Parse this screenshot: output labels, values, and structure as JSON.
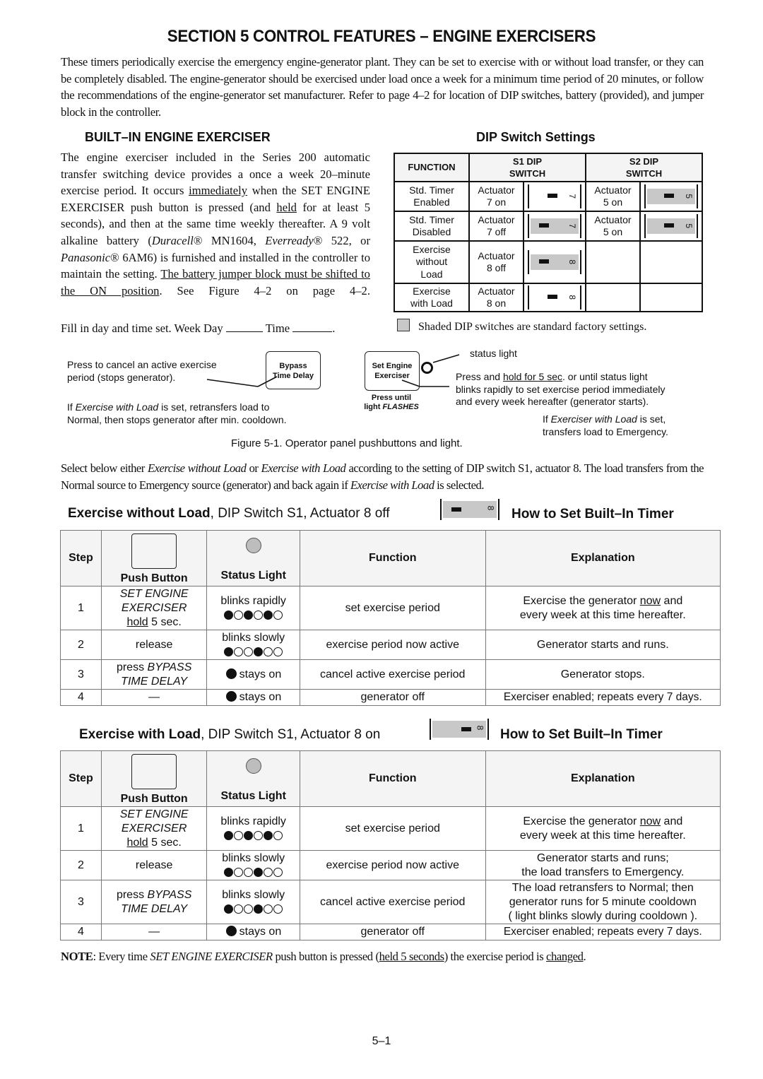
{
  "title": "SECTION 5  CONTROL FEATURES – ENGINE EXERCISERS",
  "intro": "These timers periodically exercise the emergency engine-generator plant.  They can be set to exercise with or without load transfer, or they can be completely disabled.  The engine-generator should be exercised under load once a week for a minimum time period of 20 minutes, or follow the recommendations of the engine-generator set manufacturer.  Refer to page 4–2 for location of DIP switches, battery (provided), and jumper block in the controller.",
  "builtin": {
    "heading": "BUILT–IN ENGINE EXERCISER",
    "p1": "The engine exerciser included in the Series 200 automatic transfer switching device provides a once a week 20–minute exercise period.  It occurs ",
    "u_immediately": "immediately",
    "p2": " when the SET ENGINE EXERCISER push button is pressed (and ",
    "u_held": "held",
    "p3": " for at least 5 seconds), and then at the same time weekly thereafter.  A 9 volt alkaline battery (",
    "duracell": "Duracell",
    "reg": "®",
    "p4": " MN1604, ",
    "everready": "Everready",
    "p5": " 522, or ",
    "panasonic": "Panasonic",
    "p6": " 6AM6) is furnished and installed in the controller to maintain the setting.  ",
    "u_jumper": "The battery jumper block must be shifted to the ON position",
    "p7": ".  See Figure 4–2 on page 4–2.",
    "fillin_prefix": "Fill in day and time set.  Week Day ",
    "fillin_time": " Time ",
    "fillin_end": "."
  },
  "dip": {
    "heading": "DIP Switch Settings",
    "col_function": "FUNCTION",
    "col_s1": [
      "S1 DIP",
      "SWITCH"
    ],
    "col_s2": [
      "S2 DIP",
      "SWITCH"
    ],
    "rows": [
      {
        "function": [
          "Std. Timer",
          "Enabled"
        ],
        "s1_label": [
          "Actuator",
          "7 on"
        ],
        "s1_num": "7",
        "s1_state": "on",
        "s1_shaded": false,
        "s2_label": [
          "Actuator",
          "5 on"
        ],
        "s2_num": "5",
        "s2_state": "on",
        "s2_shaded": true
      },
      {
        "function": [
          "Std. Timer",
          "Disabled"
        ],
        "s1_label": [
          "Actuator",
          "7 off"
        ],
        "s1_num": "7",
        "s1_state": "off",
        "s1_shaded": true,
        "s2_label": [
          "Actuator",
          "5 on"
        ],
        "s2_num": "5",
        "s2_state": "on",
        "s2_shaded": true
      },
      {
        "function": [
          "Exercise",
          "without",
          "Load"
        ],
        "s1_label": [
          "Actuator",
          "8 off"
        ],
        "s1_num": "8",
        "s1_state": "off",
        "s1_shaded": true
      },
      {
        "function": [
          "Exercise",
          "with Load"
        ],
        "s1_label": [
          "Actuator",
          "8 on"
        ],
        "s1_num": "8",
        "s1_state": "on",
        "s1_shaded": false
      }
    ],
    "legend": "Shaded DIP switches are standard factory settings.",
    "shade_color": "#c8c8c8"
  },
  "figure": {
    "bypass_callout": [
      "Press to cancel an active exercise",
      "period (stops generator)."
    ],
    "bypass_button": [
      "Bypass",
      "Time Delay"
    ],
    "bypass_note_pre": "If ",
    "bypass_note_it": "Exercise with Load",
    "bypass_note_post": " is set, retransfers load to",
    "bypass_note_2": "Normal, then stops generator after min. cooldown.",
    "set_button": [
      "Set Engine",
      "Exerciser"
    ],
    "press_until": "Press until",
    "light_flashes_pre": "light ",
    "light_flashes_it": "FLASHES",
    "status_light": "status light",
    "press_hold_pre": "Press and ",
    "press_hold_u": "hold for 5 sec",
    "press_hold_post": ". or until status light",
    "press_hold_2": "blinks rapidly to set exercise period immediately",
    "press_hold_3": "and every week hereafter (generator starts).",
    "ex_load_pre": "If ",
    "ex_load_it": "Exerciser with Load",
    "ex_load_post": " is set,",
    "ex_load_2": "transfers load to Emergency.",
    "caption": "Figure 5-1. Operator panel pushbuttons and light."
  },
  "select_para": {
    "a": "Select below either ",
    "b": "Exercise without Load",
    "c": " or ",
    "d": "Exercise with Load",
    "e": " according to the setting of DIP switch S1, actuator 8. The load transfers from the Normal source to Emergency source (generator) and back again if ",
    "f": "Exercise with Load",
    "g": " is selected."
  },
  "table_headers": {
    "step": "Step",
    "push_button": "Push Button",
    "status_light": "Status Light",
    "function": "Function",
    "explanation": "Explanation"
  },
  "without_load": {
    "heading_bold": "Exercise without Load",
    "heading_rest": ", DIP Switch S1, Actuator 8 off",
    "dip_num": "8",
    "dip_state": "off",
    "howto": "How to Set Built–In Timer",
    "rows": [
      {
        "step": "1",
        "pb_it": [
          "SET ENGINE",
          "EXERCISER"
        ],
        "pb_u": "hold",
        "pb_tail": " 5 sec.",
        "sl_text": "blinks rapidly",
        "sl_pattern": [
          1,
          0,
          1,
          0,
          1,
          0
        ],
        "function": "set exercise period",
        "expl_pre": "Exercise the generator ",
        "expl_u": "now",
        "expl_post": " and",
        "expl_2": "every week at this time hereafter."
      },
      {
        "step": "2",
        "pb_plain": "release",
        "sl_text": "blinks slowly",
        "sl_pattern": [
          1,
          0,
          0,
          1,
          0,
          0
        ],
        "function": "exercise period now active",
        "expl": [
          "Generator starts and runs."
        ]
      },
      {
        "step": "3",
        "pb_pre": "press ",
        "pb_it2": [
          "BYPASS",
          "TIME DELAY"
        ],
        "sl_text": "stays on",
        "sl_solid": true,
        "function": "cancel active exercise period",
        "expl": [
          "Generator stops."
        ]
      },
      {
        "step": "4",
        "pb_plain": "—",
        "sl_text": "stays on",
        "sl_solid": true,
        "function": "generator off",
        "expl": [
          "Exerciser enabled; repeats every 7 days."
        ]
      }
    ]
  },
  "with_load": {
    "heading_bold": "Exercise with Load",
    "heading_rest": ", DIP Switch S1, Actuator 8 on",
    "dip_num": "8",
    "dip_state": "on",
    "howto": "How to Set Built–In Timer",
    "rows": [
      {
        "step": "1",
        "pb_it": [
          "SET ENGINE",
          "EXERCISER"
        ],
        "pb_u": "hold",
        "pb_tail": " 5 sec.",
        "sl_text": "blinks rapidly",
        "sl_pattern": [
          1,
          0,
          1,
          0,
          1,
          0
        ],
        "function": "set exercise period",
        "expl_pre": "Exercise the generator ",
        "expl_u": "now",
        "expl_post": " and",
        "expl_2": "every week at this time hereafter."
      },
      {
        "step": "2",
        "pb_plain": "release",
        "sl_text": "blinks slowly",
        "sl_pattern": [
          1,
          0,
          0,
          1,
          0,
          0
        ],
        "function": "exercise period now active",
        "expl": [
          "Generator starts and runs;",
          "the load transfers to Emergency."
        ]
      },
      {
        "step": "3",
        "pb_pre": "press ",
        "pb_it2": [
          "BYPASS",
          "TIME DELAY"
        ],
        "sl_text": "blinks slowly",
        "sl_pattern": [
          1,
          0,
          0,
          1,
          0,
          0
        ],
        "function": "cancel active exercise period",
        "expl": [
          "The load retransfers to Normal; then",
          "generator runs for 5 minute cooldown",
          "( light blinks slowly during cooldown )."
        ]
      },
      {
        "step": "4",
        "pb_plain": "—",
        "sl_text": "stays on",
        "sl_solid": true,
        "function": "generator off",
        "expl": [
          "Exerciser enabled; repeats every 7 days."
        ]
      }
    ]
  },
  "note": {
    "label": "NOTE",
    "a": ": Every time ",
    "b": "SET ENGINE EXERCISER",
    "c": " push button is pressed (",
    "d": "held 5 seconds",
    "e": ") the exercise period is ",
    "f": "changed",
    "g": "."
  },
  "page_number": "5–1"
}
